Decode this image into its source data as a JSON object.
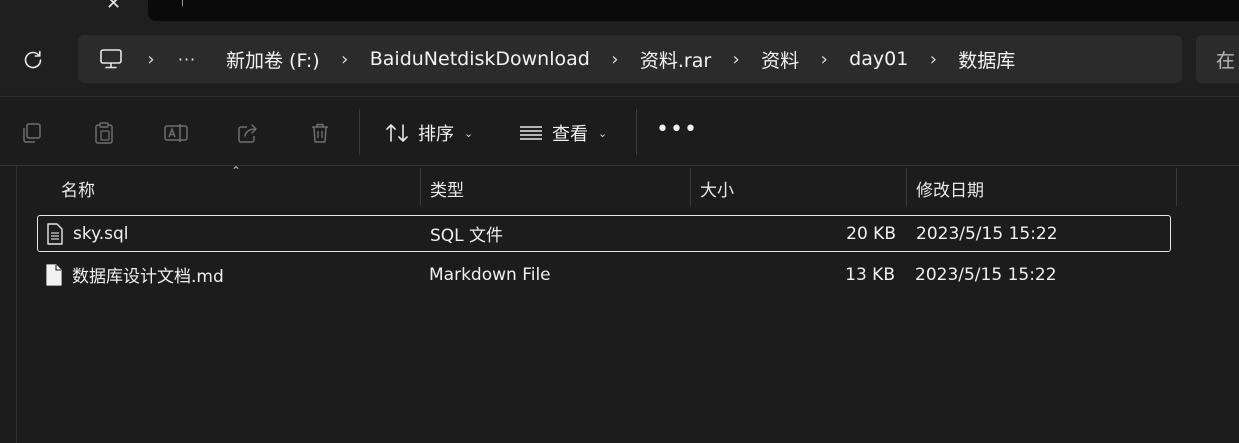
{
  "tabs": {
    "close_glyph": "✕"
  },
  "breadcrumb": {
    "more_label": "···",
    "separator": "›",
    "items": [
      "新加卷 (F:)",
      "BaiduNetdiskDownload",
      "资料.rar",
      "资料",
      "day01",
      "数据库"
    ]
  },
  "search": {
    "partial_text": "在"
  },
  "toolbar": {
    "sort_label": "排序",
    "view_label": "查看",
    "more_label": "•••"
  },
  "columns": {
    "name": "名称",
    "type": "类型",
    "size": "大小",
    "modified": "修改日期"
  },
  "files": [
    {
      "name": "sky.sql",
      "type": "SQL 文件",
      "size": "20 KB",
      "modified": "2023/5/15 15:22",
      "selected": true
    },
    {
      "name": "数据库设计文档.md",
      "type": "Markdown File",
      "size": "13 KB",
      "modified": "2023/5/15 15:22",
      "selected": false
    }
  ],
  "colors": {
    "background": "#1c1c1c",
    "bar": "#2b2b2b",
    "text": "#ffffff",
    "icon_muted": "#6e6e6e",
    "selection_border": "#e6e6e6"
  }
}
